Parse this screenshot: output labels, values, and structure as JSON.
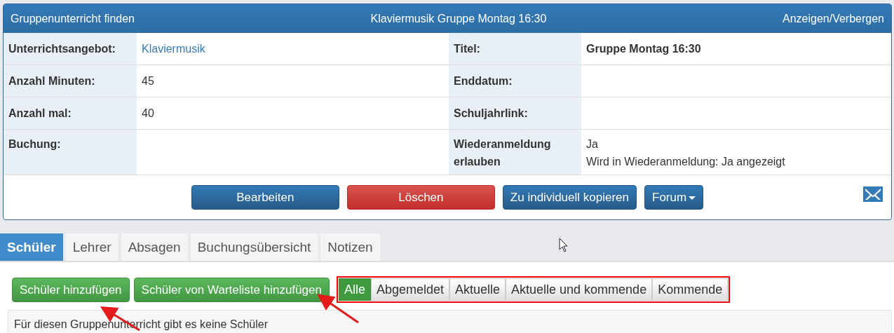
{
  "panel": {
    "left_title": "Gruppenunterricht finden",
    "center_title": "Klaviermusik Gruppe Montag 16:30",
    "toggle": "Anzeigen/Verbergen"
  },
  "details": [
    {
      "cells": [
        {
          "label": "Unterrichtsangebot:",
          "kind": "link",
          "lines": [
            "Klaviermusik"
          ]
        },
        {
          "label": "Titel:",
          "kind": "bold",
          "lines": [
            "Gruppe Montag 16:30"
          ]
        }
      ]
    },
    {
      "cells": [
        {
          "label": "Anzahl Minuten:",
          "kind": "text",
          "lines": [
            "45"
          ]
        },
        {
          "label": "Enddatum:"
        }
      ]
    },
    {
      "cells": [
        {
          "label": "Anzahl mal:",
          "kind": "text",
          "lines": [
            "40"
          ]
        },
        {
          "label": "Schuljahrlink:"
        }
      ]
    },
    {
      "cells": [
        {
          "label": "Buchung:"
        },
        {
          "label": "Wiederanmeldung erlauben",
          "kind": "text",
          "lines": [
            "Ja",
            "Wird in Wiederanmeldung: Ja angezeigt"
          ]
        }
      ]
    }
  ],
  "actions": [
    {
      "label": "Bearbeiten",
      "kind": "primary",
      "dropdown": false
    },
    {
      "label": "Löschen",
      "kind": "danger",
      "dropdown": false
    },
    {
      "label": "Zu individuell kopieren",
      "kind": "primary",
      "dropdown": false
    },
    {
      "label": "Forum",
      "kind": "primary",
      "dropdown": true
    }
  ],
  "tabs": [
    {
      "label": "Schüler",
      "selected": true
    },
    {
      "label": "Lehrer",
      "selected": false
    },
    {
      "label": "Absagen",
      "selected": false
    },
    {
      "label": "Buchungsübersicht",
      "selected": false
    },
    {
      "label": "Notizen",
      "selected": false
    }
  ],
  "student_buttons": [
    "Schüler hinzufügen",
    "Schüler von Warteliste hinzufügen"
  ],
  "filters": [
    {
      "label": "Alle",
      "selected": true
    },
    {
      "label": "Abgemeldet",
      "selected": false
    },
    {
      "label": "Aktuelle",
      "selected": false
    },
    {
      "label": "Aktuelle und kommende",
      "selected": false
    },
    {
      "label": "Kommende",
      "selected": false
    }
  ],
  "message": "Für diesen Gruppenunterricht gibt es keine Schüler"
}
